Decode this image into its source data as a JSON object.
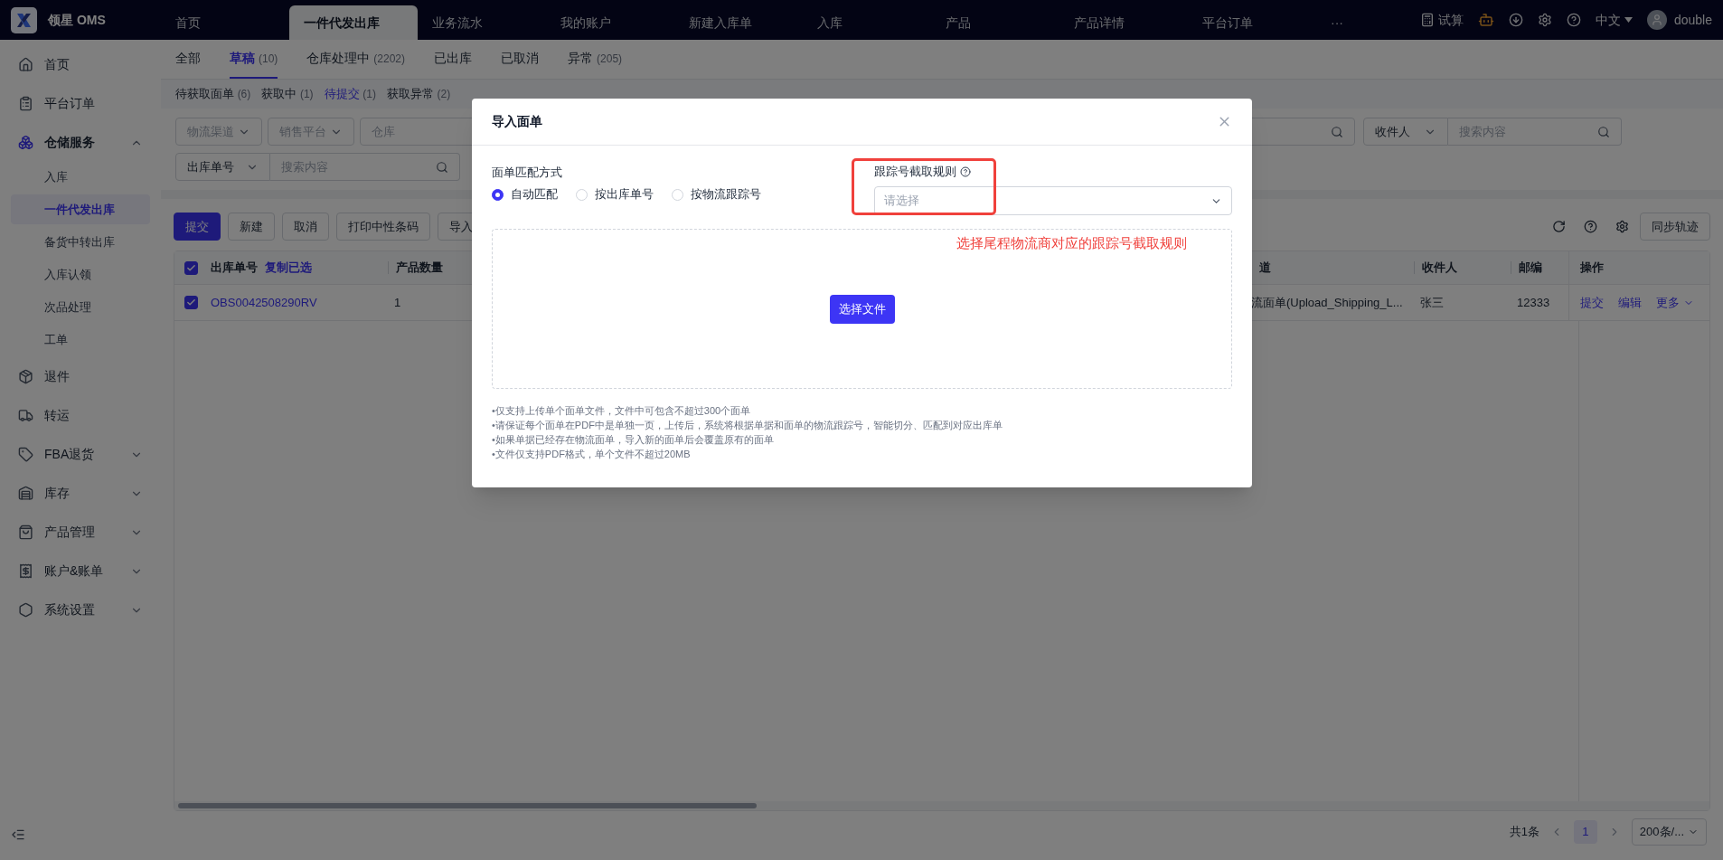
{
  "app": {
    "logo_text": "领星 OMS"
  },
  "top_tabs": [
    {
      "label": "首页",
      "selected": false
    },
    {
      "label": "一件代发出库",
      "selected": true
    },
    {
      "label": "业务流水",
      "selected": false
    },
    {
      "label": "我的账户",
      "selected": false
    },
    {
      "label": "新建入库单",
      "selected": false
    },
    {
      "label": "入库",
      "selected": false
    },
    {
      "label": "产品",
      "selected": false
    },
    {
      "label": "产品详情",
      "selected": false
    },
    {
      "label": "平台订单",
      "selected": false
    }
  ],
  "top_more": "···",
  "header_tools": {
    "calc": "试算",
    "language": "中文",
    "user": "double"
  },
  "sidebar": {
    "items": [
      {
        "label": "首页",
        "kind": "link"
      },
      {
        "label": "平台订单",
        "kind": "link"
      },
      {
        "label": "仓储服务",
        "kind": "group",
        "expanded": true,
        "children": [
          {
            "label": "入库",
            "selected": false
          },
          {
            "label": "一件代发出库",
            "selected": true
          },
          {
            "label": "备货中转出库",
            "selected": false
          },
          {
            "label": "入库认领",
            "selected": false
          },
          {
            "label": "次品处理",
            "selected": false
          },
          {
            "label": "工单",
            "selected": false
          }
        ]
      },
      {
        "label": "退件",
        "kind": "link"
      },
      {
        "label": "转运",
        "kind": "link"
      },
      {
        "label": "FBA退货",
        "kind": "group",
        "expanded": false
      },
      {
        "label": "库存",
        "kind": "group",
        "expanded": false
      },
      {
        "label": "产品管理",
        "kind": "group",
        "expanded": false
      },
      {
        "label": "账户&账单",
        "kind": "group",
        "expanded": false
      },
      {
        "label": "系统设置",
        "kind": "group",
        "expanded": false
      }
    ]
  },
  "status_tabs": [
    {
      "label": "全部",
      "selected": false
    },
    {
      "label": "草稿",
      "count": "(10)",
      "selected": true
    },
    {
      "label": "仓库处理中",
      "count": "(2202)",
      "selected": false
    },
    {
      "label": "已出库",
      "selected": false
    },
    {
      "label": "已取消",
      "selected": false
    },
    {
      "label": "异常",
      "count": "(205)",
      "selected": false
    }
  ],
  "sub_tabs": [
    {
      "label": "待获取面单",
      "count": "(6)",
      "selected": false
    },
    {
      "label": "获取中",
      "count": "(1)",
      "selected": false
    },
    {
      "label": "待提交",
      "count": "(1)",
      "selected": true
    },
    {
      "label": "获取异常",
      "count": "(2)",
      "selected": false
    }
  ],
  "filters": {
    "channel": "物流渠道",
    "platform": "销售平台",
    "warehouse": "仓库",
    "receiver_select": "收件人",
    "receiver_search": "搜索内容",
    "order_select": "出库单号",
    "order_search": "搜索内容"
  },
  "toolbar": {
    "buttons": [
      {
        "label": "提交",
        "kind": "primary"
      },
      {
        "label": "新建",
        "kind": "default"
      },
      {
        "label": "取消",
        "kind": "default"
      },
      {
        "label": "打印中性条码",
        "kind": "default"
      },
      {
        "label": "导入",
        "kind": "default"
      }
    ],
    "sync": "同步轨迹"
  },
  "table": {
    "header_checked": true,
    "copy_link": "复制已选",
    "columns": [
      "出库单号",
      "产品数量",
      "道",
      "收件人",
      "邮编",
      "操作"
    ],
    "rows": [
      {
        "checked": true,
        "order_no": "OBS0042508290RV",
        "quantity": "1",
        "channel": "流面单(Upload_Shipping_L...",
        "receiver": "张三",
        "zip": "12333",
        "actions": [
          "提交",
          "编辑",
          "更多"
        ]
      }
    ]
  },
  "pagination": {
    "total": "共1条",
    "pages": [
      {
        "label": "1",
        "selected": true
      }
    ],
    "page_size": "200条/..."
  },
  "modal": {
    "title": "导入面单",
    "match_label": "面单匹配方式",
    "options": [
      {
        "label": "自动匹配",
        "selected": true
      },
      {
        "label": "按出库单号",
        "selected": false
      },
      {
        "label": "按物流跟踪号",
        "selected": false
      }
    ],
    "rule_label": "跟踪号截取规则",
    "rule_placeholder": "请选择",
    "annotation": "选择尾程物流商对应的跟踪号截取规则",
    "upload_button": "选择文件",
    "notes": [
      "•仅支持上传单个面单文件，文件中可包含不超过300个面单",
      "•请保证每个面单在PDF中是单独一页，上传后，系统将根据单据和面单的物流跟踪号，智能切分、匹配到对应出库单",
      "•如果单据已经存在物流面单，导入新的面单后会覆盖原有的面单",
      "•文件仅支持PDF格式，单个文件不超过20MB"
    ]
  }
}
